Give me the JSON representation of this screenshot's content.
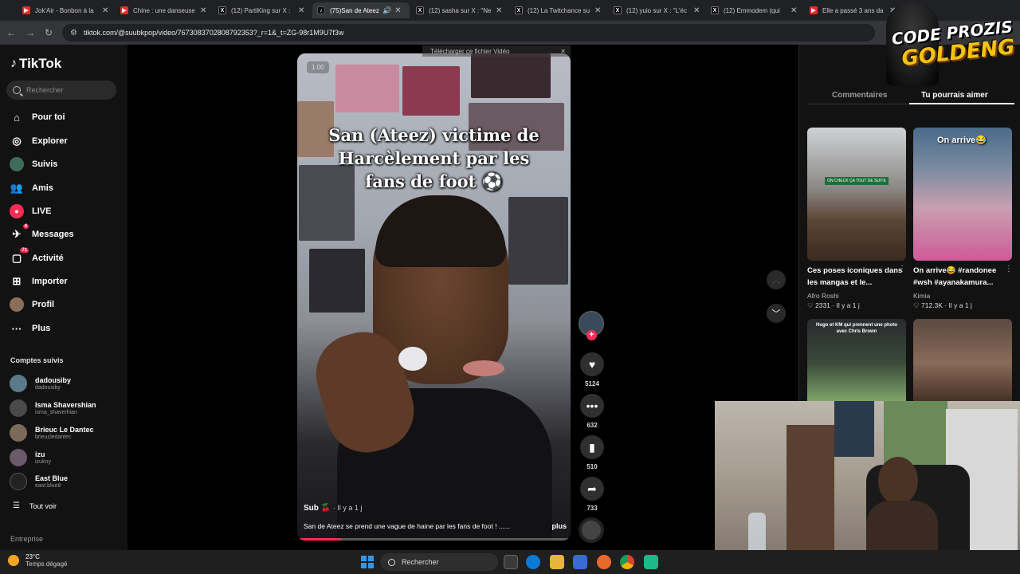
{
  "browser": {
    "tabs": [
      {
        "title": "Jok'Air - Bonbon à la",
        "icon": "youtube-icon"
      },
      {
        "title": "Chine : une danseuse",
        "icon": "youtube-icon"
      },
      {
        "title": "(12) PartiKing sur X :",
        "icon": "x-icon"
      },
      {
        "title": "(75)San de Ateez",
        "icon": "tiktok-icon"
      },
      {
        "title": "(12) sasha sur X : \"Ne",
        "icon": "x-icon"
      },
      {
        "title": "(12) La Twitchance su",
        "icon": "x-icon"
      },
      {
        "title": "(12) yuio sur X : \"L'éc",
        "icon": "x-icon"
      },
      {
        "title": "(12) Emmodem (qui",
        "icon": "x-icon"
      },
      {
        "title": "Elle a passé 3 ans da",
        "icon": "youtube-icon"
      }
    ],
    "url": "tiktok.com/@suubkpop/video/7673083702808792353?_r=1&_t=ZG-98r1M9U7f3w"
  },
  "tiktok": {
    "logo": "TikTok",
    "search_placeholder": "Rechercher",
    "nav": [
      {
        "label": "Pour toi",
        "icon": "home-icon"
      },
      {
        "label": "Explorer",
        "icon": "compass-icon"
      },
      {
        "label": "Suivis",
        "icon": "following-avatar-icon"
      },
      {
        "label": "Amis",
        "icon": "friends-icon"
      },
      {
        "label": "LIVE",
        "icon": "live-icon"
      },
      {
        "label": "Messages",
        "icon": "messages-icon",
        "badge": "4"
      },
      {
        "label": "Activité",
        "icon": "activity-icon",
        "badge": "71"
      },
      {
        "label": "Importer",
        "icon": "upload-icon"
      },
      {
        "label": "Profil",
        "icon": "profile-avatar-icon"
      },
      {
        "label": "Plus",
        "icon": "more-icon"
      }
    ],
    "followed_title": "Comptes suivis",
    "followed": [
      {
        "name": "dadousiby",
        "handle": "dadousiby"
      },
      {
        "name": "Isma Shavershian",
        "handle": "isma_shaverhian"
      },
      {
        "name": "Brieuc Le Dantec",
        "handle": "brieucledantec"
      },
      {
        "name": "izu",
        "handle": "izukny"
      },
      {
        "name": "East Blue",
        "handle": "east.blue8"
      }
    ],
    "see_all": "Tout voir",
    "enterprise": "Entreprise"
  },
  "video": {
    "timer": "1:00",
    "download_banner": "Télécharger ce fichier Vidéo",
    "caption_lines": [
      "San (Ateez) victime de",
      "Harcèlement par les",
      "fans de foot ⚽"
    ],
    "author": "Sub 🍒",
    "date": "· Il y a 1 j",
    "description": "San de Ateez se prend une vague de haine par les fans de foot ! ......",
    "more": "plus",
    "progress": 0.16,
    "likes": "5124",
    "comments": "632",
    "saves": "510",
    "shares": "733"
  },
  "panel": {
    "tab_comments": "Commentaires",
    "tab_related": "Tu pourrais aimer",
    "items": [
      {
        "title": "Ces poses iconiques dans les mangas et le...",
        "author": "Afro Roshi",
        "likes": "2331",
        "date": "Il y a 1 j",
        "overlay": "ON CHECK ÇA TOUT DE SUITE"
      },
      {
        "title": "On arrive😂 #randonee #wsh #ayanakamura...",
        "author": "Kimia",
        "likes": "712.3K",
        "date": "Il y a 1 j",
        "overlay": "On arrive😂"
      },
      {
        "title": "",
        "author": "",
        "likes": "",
        "date": "",
        "overlay": "Hugo et KM qui prennent une photo avec Chris Brown"
      },
      {
        "title": "",
        "author": "",
        "likes": "",
        "date": "",
        "overlay": ""
      }
    ]
  },
  "overlay": {
    "logo_line1": "CODE PROZIS",
    "logo_line2": "GOLDENG"
  },
  "taskbar": {
    "temp": "23°C",
    "weather": "Temps dégagé",
    "search": "Rechercher"
  },
  "colors": {
    "accent": "#fe2c55",
    "logo_gold": "#f1c40f"
  }
}
